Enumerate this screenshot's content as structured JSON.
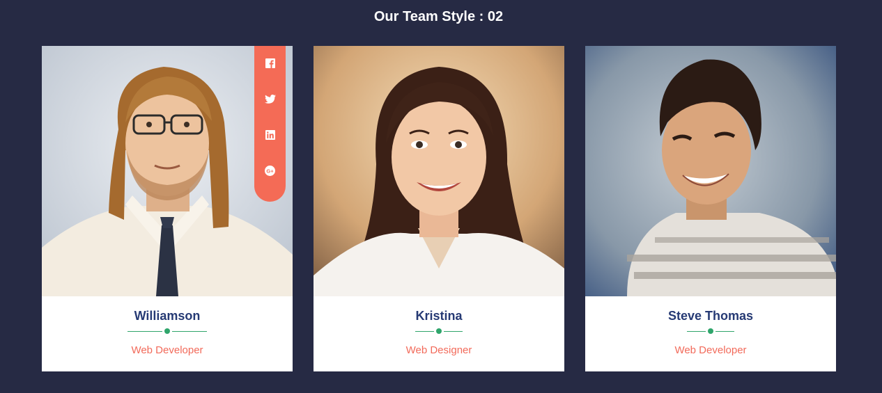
{
  "page": {
    "title": "Our Team Style : 02"
  },
  "colors": {
    "background": "#262a44",
    "name": "#263a74",
    "role": "#f26a5a",
    "divider": "#2fa56b",
    "social_panel": "#f46b56"
  },
  "team": [
    {
      "name": "Williamson",
      "role": "Web Developer",
      "social": [
        "facebook-icon",
        "twitter-icon",
        "linkedin-icon",
        "google-plus-icon"
      ]
    },
    {
      "name": "Kristina",
      "role": "Web Designer"
    },
    {
      "name": "Steve Thomas",
      "role": "Web Developer"
    }
  ]
}
